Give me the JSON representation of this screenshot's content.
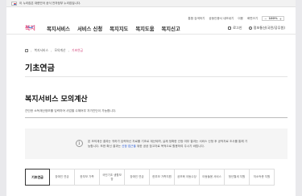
{
  "gov_banner": {
    "text": "이 누리집은 대한민국 공식 전자정부 누리집입니다.",
    "link": ""
  },
  "header": {
    "logo_text": "복지",
    "nav": [
      "복지서비스",
      "서비스 신청",
      "복지지도",
      "복지도움",
      "복지신고"
    ],
    "util_links": [
      "통합 검색하기",
      "공동인증서 내보내기",
      "이용",
      "화면크기"
    ],
    "zoom": {
      "minus": "−",
      "value": "100%",
      "plus": "+"
    },
    "login_label": "로그인",
    "mobile_label": "정보통신(국민/공무원)"
  },
  "breadcrumb": {
    "items": [
      "복지서비스",
      "모의계산",
      "기초연금"
    ]
  },
  "page": {
    "title": "기초연금"
  },
  "section": {
    "title": "복지서비스 모의계산",
    "description": "간단한 소득재산정보를 입력하여 사업별 수혜여부 자가진단이 가능합니다."
  },
  "notice": {
    "text_before": "본 모의계산 결과는 귀하가 입력하신 자료를 기초로 계산되며, 실제 정확한 선정 여부 결과는 서비스 신청 후 공적자료 조사를 통해 가능합니다. 또한 확신 결과는",
    "link_text": "신청 접근을",
    "text_after": "위한 공공 참고자료 목적으로 활용하여 주시기 바랍니다."
  },
  "tabs": [
    {
      "label": "기초연금",
      "active": true
    },
    {
      "label": "장애인 연금",
      "active": false
    },
    {
      "label": "한부모 가족",
      "active": false
    },
    {
      "label": "국민기초 생활보장",
      "active": false
    },
    {
      "label": "장애인 연금",
      "active": false
    },
    {
      "label": "한부모 가족지원",
      "active": false
    },
    {
      "label": "공보육 아동수당",
      "active": false
    },
    {
      "label": "아동돌봄 서비스",
      "active": false
    },
    {
      "label": "청년월세 지원",
      "active": false
    },
    {
      "label": "저소득층 지원",
      "active": false
    }
  ]
}
